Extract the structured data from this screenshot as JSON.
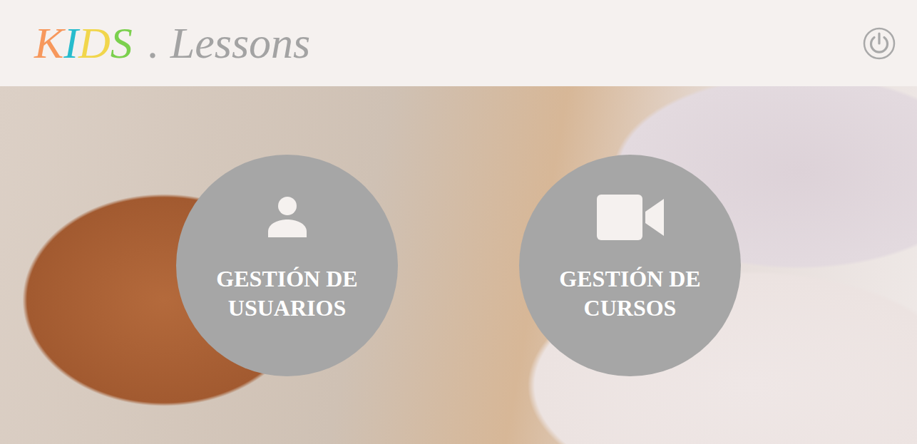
{
  "logo": {
    "letters": [
      {
        "text": "K",
        "color": "#f7985c"
      },
      {
        "text": "I",
        "color": "#27bccd"
      },
      {
        "text": "D",
        "color": "#f1d64c"
      },
      {
        "text": "S",
        "color": "#7bd04d"
      }
    ],
    "rest": ". Lessons"
  },
  "tiles": [
    {
      "label": "GESTIÓN DE USUARIOS",
      "kind": "users"
    },
    {
      "label": "GESTIÓN DE CURSOS",
      "kind": "courses"
    }
  ]
}
